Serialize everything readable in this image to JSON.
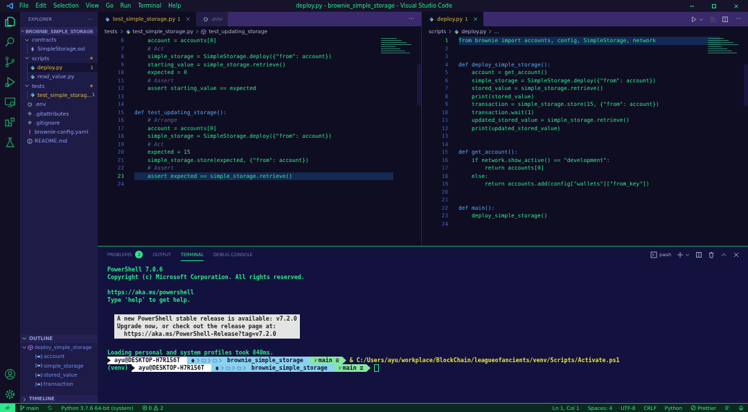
{
  "window": {
    "title": "deploy.py - brownie_simple_storage - Visual Studio Code"
  },
  "menu": [
    "File",
    "Edit",
    "Selection",
    "View",
    "Go",
    "Run",
    "Terminal",
    "Help"
  ],
  "sidebar": {
    "title": "EXPLORER",
    "more": "···",
    "root": "BROWNIE_SIMPLE_STORAGE",
    "items": [
      {
        "label": "contracts",
        "kind": "folder",
        "expanded": true,
        "modified": false,
        "children": [
          {
            "label": "SimpleStorage.sol",
            "kind": "solidity",
            "selected": false
          }
        ]
      },
      {
        "label": "scripts",
        "kind": "folder",
        "expanded": true,
        "modified": true,
        "children": [
          {
            "label": "deploy.py",
            "kind": "python",
            "badge": "1",
            "selected": true
          },
          {
            "label": "read_value.py",
            "kind": "python",
            "selected": false
          }
        ]
      },
      {
        "label": "tests",
        "kind": "folder",
        "expanded": true,
        "modified": true,
        "children": [
          {
            "label": "test_simple_storag...",
            "kind": "python",
            "badge": "1",
            "selected": false
          }
        ]
      },
      {
        "label": ".env",
        "kind": "config",
        "selected": false
      },
      {
        "label": ".gitattributes",
        "kind": "git",
        "selected": false
      },
      {
        "label": ".gitignore",
        "kind": "git",
        "selected": false
      },
      {
        "label": "brownie-config.yaml",
        "kind": "yaml",
        "selected": false
      },
      {
        "label": "README.md",
        "kind": "readme",
        "selected": false
      }
    ],
    "outline": {
      "title": "OUTLINE",
      "items": [
        {
          "label": "deploy_simple_storage",
          "kind": "function",
          "expanded": true,
          "children": [
            {
              "label": "account",
              "kind": "variable"
            },
            {
              "label": "simple_storage",
              "kind": "variable"
            },
            {
              "label": "stored_value",
              "kind": "variable"
            },
            {
              "label": "transaction",
              "kind": "variable"
            }
          ]
        }
      ]
    },
    "timeline": "TIMELINE"
  },
  "editors": [
    {
      "tabs": [
        {
          "label": "test_simple_storage.py",
          "kind": "python",
          "badge": "1",
          "selected": true
        },
        {
          "label": ".env",
          "kind": "config",
          "selected": false
        }
      ],
      "breadcrumbs": [
        "tests",
        "test_simple_storage.py",
        "test_updating_storage"
      ],
      "lines": [
        {
          "n": "6",
          "current": false,
          "kind": "code",
          "text": "    account = accounts[0]"
        },
        {
          "n": "7",
          "current": false,
          "kind": "comment",
          "text": "    # Act"
        },
        {
          "n": "8",
          "current": false,
          "kind": "code",
          "text": "    simple_storage = SimpleStorage.deploy({\"from\": account})"
        },
        {
          "n": "9",
          "current": false,
          "kind": "code",
          "text": "    starting_value = simple_storage.retrieve()"
        },
        {
          "n": "10",
          "current": false,
          "kind": "code",
          "text": "    expected = 0"
        },
        {
          "n": "11",
          "current": false,
          "kind": "comment",
          "text": "    # Assert"
        },
        {
          "n": "12",
          "current": false,
          "kind": "code",
          "text": "    assert starting_value == expected"
        },
        {
          "n": "13",
          "current": false
        },
        {
          "n": "14",
          "current": false
        },
        {
          "n": "15",
          "current": false,
          "kind": "def",
          "text": "def test_updating_storage():"
        },
        {
          "n": "16",
          "current": false,
          "kind": "comment",
          "text": "    # Arrange"
        },
        {
          "n": "17",
          "current": false,
          "kind": "code",
          "text": "    account = accounts[0]"
        },
        {
          "n": "18",
          "current": false,
          "kind": "code",
          "text": "    simple_storage = SimpleStorage.deploy({\"from\": account})"
        },
        {
          "n": "19",
          "current": false,
          "kind": "comment",
          "text": "    # Act"
        },
        {
          "n": "20",
          "current": false,
          "kind": "code",
          "text": "    expected = 15"
        },
        {
          "n": "21",
          "current": false,
          "kind": "code",
          "text": "    simple_storage.store(expected, {\"from\": account})"
        },
        {
          "n": "22",
          "current": false,
          "kind": "comment",
          "text": "    # Assert"
        },
        {
          "n": "23",
          "current": true,
          "kind": "code",
          "text": "    assert expected == simple_storage.retrieve()"
        },
        {
          "n": "24",
          "current": false
        }
      ]
    },
    {
      "tabs": [
        {
          "label": "deploy.py",
          "kind": "python",
          "badge": "1",
          "selected": true
        }
      ],
      "breadcrumbs": [
        "scripts",
        "deploy.py",
        "..."
      ],
      "lines": [
        {
          "n": "1",
          "current": true,
          "kind": "code",
          "text": "from brownie import accounts, config, SimpleStorage, network"
        },
        {
          "n": "2",
          "current": false
        },
        {
          "n": "3",
          "current": false
        },
        {
          "n": "4",
          "current": false,
          "kind": "def",
          "text": "def deploy_simple_storage():"
        },
        {
          "n": "5",
          "current": false,
          "kind": "code",
          "text": "    account = get_account()"
        },
        {
          "n": "6",
          "current": false,
          "kind": "code",
          "text": "    simple_storage = SimpleStorage.deploy({\"from\": account})"
        },
        {
          "n": "7",
          "current": false,
          "kind": "code",
          "text": "    stored_value = simple_storage.retrieve()"
        },
        {
          "n": "8",
          "current": false,
          "kind": "code",
          "text": "    print(stored_value)"
        },
        {
          "n": "9",
          "current": false,
          "kind": "code",
          "text": "    transaction = simple_storage.store(15, {\"from\": account})"
        },
        {
          "n": "10",
          "current": false,
          "kind": "code",
          "text": "    transaction.wait(1)"
        },
        {
          "n": "11",
          "current": false,
          "kind": "code",
          "text": "    updated_stored_value = simple_storage.retrieve()"
        },
        {
          "n": "12",
          "current": false,
          "kind": "code",
          "text": "    print(updated_stored_value)"
        },
        {
          "n": "13",
          "current": false
        },
        {
          "n": "14",
          "current": false
        },
        {
          "n": "15",
          "current": false,
          "kind": "def",
          "text": "def get_account():"
        },
        {
          "n": "16",
          "current": false,
          "kind": "code",
          "text": "    if network.show_active() == \"development\":"
        },
        {
          "n": "17",
          "current": false,
          "kind": "code",
          "text": "        return accounts[0]"
        },
        {
          "n": "18",
          "current": false,
          "kind": "code",
          "text": "    else:"
        },
        {
          "n": "19",
          "current": false,
          "kind": "code",
          "text": "        return accounts.add(config[\"wallets\"][\"from_key\"])"
        },
        {
          "n": "20",
          "current": false
        },
        {
          "n": "21",
          "current": false
        },
        {
          "n": "22",
          "current": false,
          "kind": "def",
          "text": "def main():"
        },
        {
          "n": "23",
          "current": false,
          "kind": "code",
          "text": "    deploy_simple_storage()"
        },
        {
          "n": "24",
          "current": false
        }
      ]
    }
  ],
  "panel": {
    "tabs": [
      {
        "label": "PROBLEMS",
        "badge": "2",
        "selected": false
      },
      {
        "label": "OUTPUT",
        "selected": false
      },
      {
        "label": "TERMINAL",
        "selected": true
      },
      {
        "label": "DEBUG CONSOLE",
        "selected": false
      }
    ],
    "shell": "pwsh",
    "terminal": [
      {
        "kind": "text",
        "text": "PowerShell 7.0.6"
      },
      {
        "kind": "text",
        "text": "Copyright (c) Microsoft Corporation. All rights reserved."
      },
      {
        "kind": "blank"
      },
      {
        "kind": "text",
        "text": "https://aka.ms/powershell"
      },
      {
        "kind": "text",
        "text": "Type 'help' to get help."
      },
      {
        "kind": "blank"
      },
      {
        "kind": "box",
        "lines": [
          "A new PowerShell stable release is available: v7.2.0",
          "Upgrade now, or check out the release page at:",
          "  https://aka.ms/PowerShell-Release?tag=v7.2.0"
        ]
      },
      {
        "kind": "blank"
      },
      {
        "kind": "text",
        "text": "Loading personal and system profiles took 840ms."
      },
      {
        "kind": "prompt",
        "user": "ayu@DESKTOP-H7R156T",
        "path": "brownie_simple_storage",
        "branch": "main ≡",
        "command": "& C:/Users/ayu/workplace/BlockChain/leagueofancients/venv/Scripts/Activate.ps1",
        "cursor": false
      },
      {
        "kind": "prompt",
        "prefix": "(venv)",
        "user": "ayu@DESKTOP-H7R156T",
        "path": "brownie_simple_storage",
        "branch": "main ≡",
        "cursor": true
      }
    ]
  },
  "status_bar": {
    "branch": "main",
    "interpreter": "Python 3.7.6 64-bit (system)",
    "errors": "0",
    "warnings": "2",
    "position": "Ln 1, Col 1",
    "spaces": "Spaces: 4",
    "encoding": "UTF-8",
    "eol": "CRLF",
    "language": "Python",
    "formatter": "Prettier"
  }
}
